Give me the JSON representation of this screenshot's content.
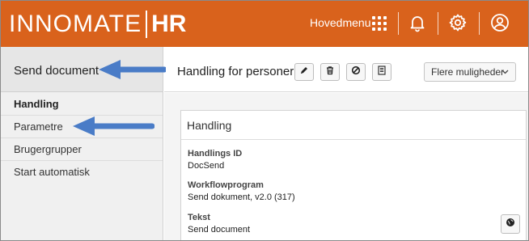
{
  "topbar": {
    "logo_main": "INNOMATE",
    "logo_hr": "HR",
    "menu_label": "Hovedmenu",
    "icons": [
      "grid-icon",
      "bell-icon",
      "gear-icon",
      "user-icon"
    ],
    "color": "#d9621c"
  },
  "sidebar": {
    "title": "Send document",
    "items": [
      {
        "label": "Handling",
        "active": true
      },
      {
        "label": "Parametre",
        "active": false
      },
      {
        "label": "Brugergrupper",
        "active": false
      },
      {
        "label": "Start automatisk",
        "active": false
      }
    ]
  },
  "main": {
    "title": "Handling for personer",
    "toolbar": {
      "icons": [
        "edit-icon",
        "delete-icon",
        "disable-icon",
        "document-icon"
      ],
      "more_label": "Flere muligheder"
    },
    "panel": {
      "title": "Handling",
      "fields": [
        {
          "label": "Handlings ID",
          "value": "DocSend"
        },
        {
          "label": "Workflowprogram",
          "value": "Send dokument, v2.0 (317)"
        },
        {
          "label": "Tekst",
          "value": "Send document"
        }
      ]
    }
  },
  "annotation": {
    "arrow_color": "#4a7cc7"
  }
}
